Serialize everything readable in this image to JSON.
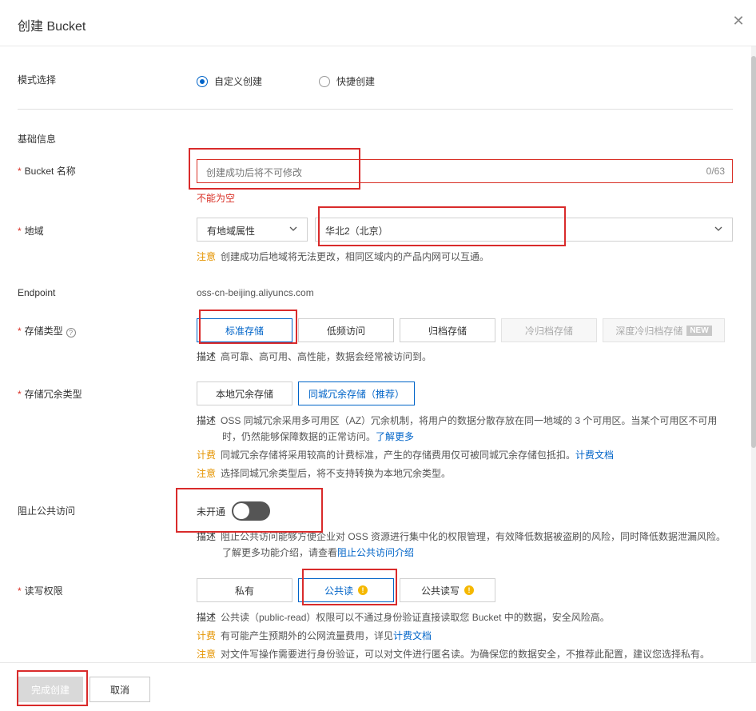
{
  "dialog": {
    "title": "创建 Bucket"
  },
  "mode": {
    "label": "模式选择",
    "options": [
      {
        "label": "自定义创建",
        "checked": true
      },
      {
        "label": "快捷创建",
        "checked": false
      }
    ]
  },
  "basic_section_title": "基础信息",
  "bucket_name": {
    "label": "Bucket 名称",
    "placeholder": "创建成功后将不可修改",
    "value": "",
    "counter": "0/63",
    "error": "不能为空"
  },
  "region": {
    "label": "地域",
    "type_select": "有地域属性",
    "region_select": "华北2（北京）",
    "note_tag": "注意",
    "note_text": "创建成功后地域将无法更改，相同区域内的产品内网可以互通。"
  },
  "endpoint": {
    "label": "Endpoint",
    "value": "oss-cn-beijing.aliyuncs.com"
  },
  "storage_class": {
    "label": "存储类型",
    "help_icon": "question-circle-icon",
    "options": [
      {
        "label": "标准存储",
        "state": "selected"
      },
      {
        "label": "低频访问",
        "state": "normal"
      },
      {
        "label": "归档存储",
        "state": "normal"
      },
      {
        "label": "冷归档存储",
        "state": "disabled"
      },
      {
        "label": "深度冷归档存储",
        "state": "disabled",
        "badge": "NEW"
      }
    ],
    "desc_tag": "描述",
    "desc_text": "高可靠、高可用、高性能，数据会经常被访问到。"
  },
  "redundancy": {
    "label": "存储冗余类型",
    "options": [
      {
        "label": "本地冗余存储",
        "state": "normal"
      },
      {
        "label": "同城冗余存储（推荐）",
        "state": "selected"
      }
    ],
    "desc_tag": "描述",
    "desc_line1": "OSS 同城冗余采用多可用区（AZ）冗余机制，将用户的数据分散存放在同一地域的 3 个可用区。当某个可用区不可用",
    "desc_line2": "时，仍然能够保障数据的正常访问。",
    "desc_link": "了解更多",
    "billing_tag": "计费",
    "billing_text": "同城冗余存储将采用较高的计费标准，产生的存储费用仅可被同城冗余存储包抵扣。",
    "billing_link": "计费文档",
    "note_tag": "注意",
    "note_text": "选择同城冗余类型后，将不支持转换为本地冗余类型。"
  },
  "block_public": {
    "label": "阻止公共访问",
    "toggle_label": "未开通",
    "enabled": false,
    "desc_tag": "描述",
    "desc_line1": "阻止公共访问能够方便企业对 OSS 资源进行集中化的权限管理，有效降低数据被盗刷的风险，同时降低数据泄漏风险。",
    "desc_line2": "了解更多功能介绍，请查看",
    "desc_link": "阻止公共访问介绍"
  },
  "acl": {
    "label": "读写权限",
    "options": [
      {
        "label": "私有",
        "state": "normal",
        "warn": false
      },
      {
        "label": "公共读",
        "state": "selected",
        "warn": true
      },
      {
        "label": "公共读写",
        "state": "normal",
        "warn": true
      }
    ],
    "desc_tag": "描述",
    "desc_text": "公共读（public-read）权限可以不通过身份验证直接读取您 Bucket 中的数据，安全风险高。",
    "billing_tag": "计费",
    "billing_text": "有可能产生预期外的公网流量费用，详见",
    "billing_link": "计费文档",
    "note_tag": "注意",
    "note_text": "对文件写操作需要进行身份验证，可以对文件进行匿名读。为确保您的数据安全，不推荐此配置，建议您选择私有。"
  },
  "footer": {
    "submit": "完成创建",
    "cancel": "取消"
  },
  "colors": {
    "accent": "#0064c8",
    "error": "#d93026",
    "warning": "#e59400",
    "highlight_box": "#d92b2b"
  }
}
